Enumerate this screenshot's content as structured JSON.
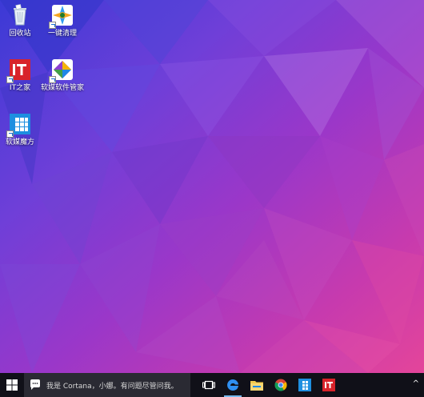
{
  "desktop": {
    "icons": [
      {
        "label": "回收站",
        "icon": "recycle-bin-icon"
      },
      {
        "label": "一键清理",
        "icon": "cleaner-icon"
      },
      {
        "label": "IT之家",
        "icon": "ithome-icon"
      },
      {
        "label": "软媒软件管家",
        "icon": "software-manager-icon"
      },
      {
        "label": "软媒魔方",
        "icon": "rubik-cube-icon"
      }
    ]
  },
  "taskbar": {
    "search_placeholder": "我是 Cortana，小娜。有问题尽管问我。",
    "start_icon": "windows-logo-icon",
    "pinned": [
      {
        "icon": "task-view-icon"
      },
      {
        "icon": "edge-icon"
      },
      {
        "icon": "file-explorer-icon"
      },
      {
        "icon": "chrome-icon"
      },
      {
        "icon": "rubik-cube-icon"
      },
      {
        "icon": "ithome-icon"
      }
    ],
    "colors": {
      "background": "#101018",
      "search_background": "#2a2a33",
      "active_indicator": "#76b9ed"
    }
  }
}
